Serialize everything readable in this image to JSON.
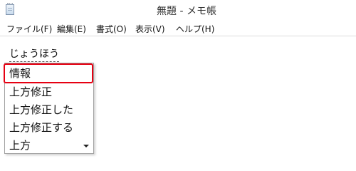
{
  "window": {
    "title": "無題 - メモ帳"
  },
  "menu": {
    "items": [
      {
        "label": "ファイル(F)"
      },
      {
        "label": "編集(E)"
      },
      {
        "label": "書式(O)"
      },
      {
        "label": "表示(V)"
      },
      {
        "label": "ヘルプ(H)"
      }
    ]
  },
  "editor": {
    "text": "じょうほう"
  },
  "ime": {
    "candidates": [
      {
        "label": "情報",
        "selected": true
      },
      {
        "label": "上方修正"
      },
      {
        "label": "上方修正した"
      },
      {
        "label": "上方修正する"
      },
      {
        "label": "上方"
      }
    ],
    "scroll_icon": "chevron-down-icon",
    "highlight_color": "#e60012"
  }
}
